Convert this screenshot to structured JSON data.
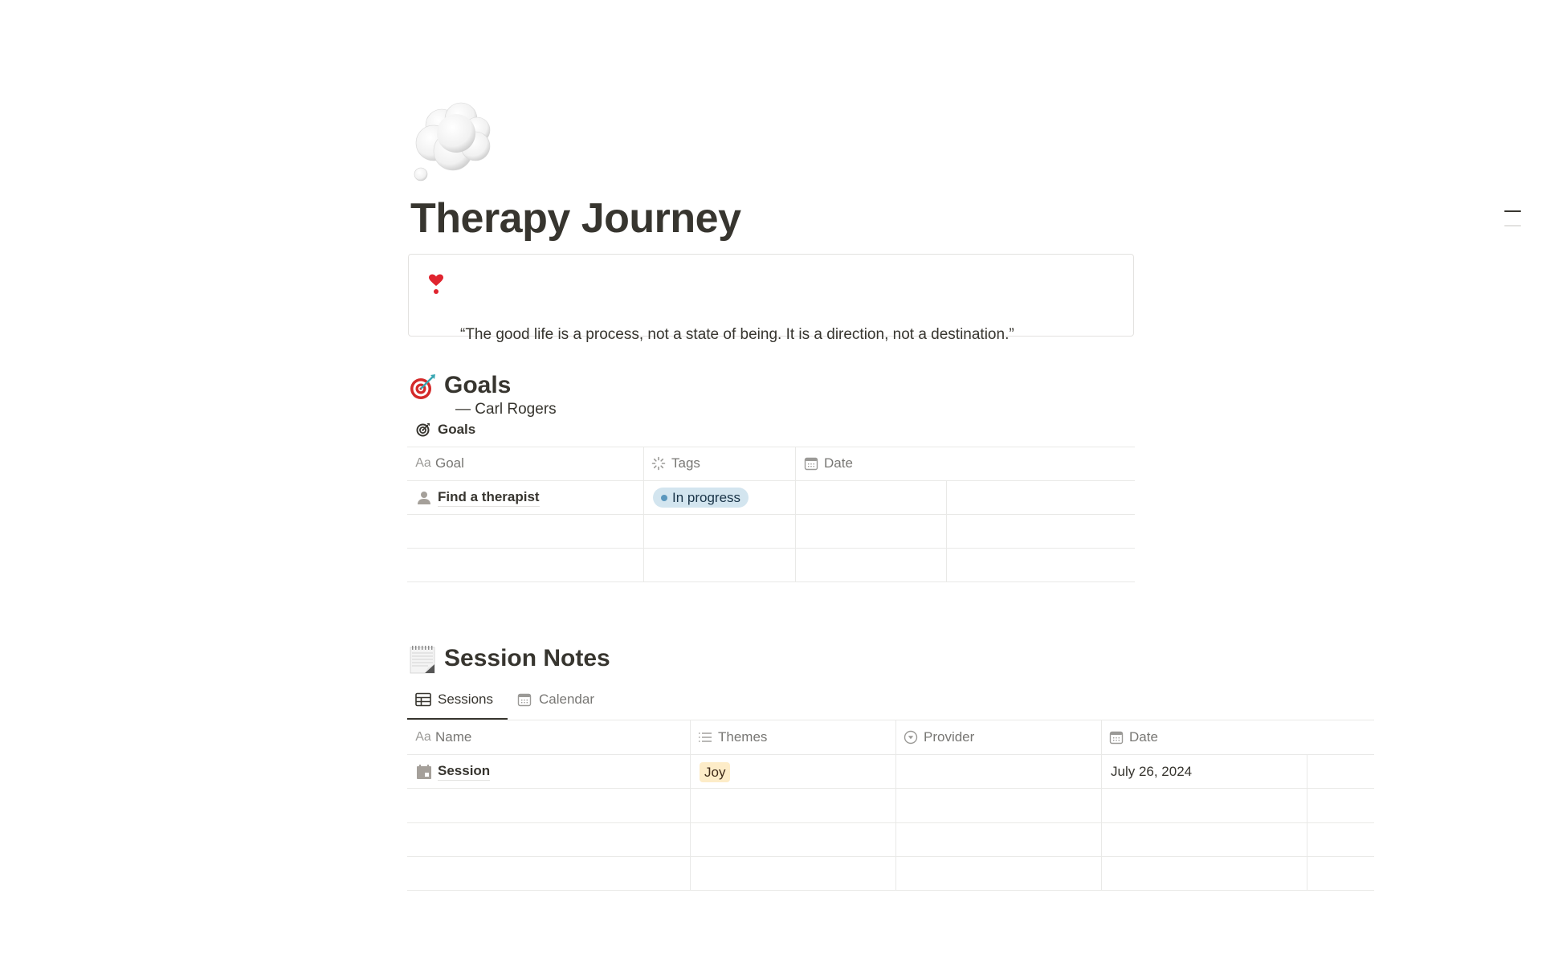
{
  "page": {
    "icon": "thought-balloon-emoji",
    "title": "Therapy Journey"
  },
  "callout": {
    "icon": "heavy-heart-exclamation-emoji",
    "quote": "“The good life is a process, not a state of being. It is a direction, not a destination.”",
    "attribution": "— Carl Rogers"
  },
  "goals_section": {
    "heading_icon": "direct-hit-emoji",
    "heading": "Goals",
    "database": {
      "icon": "target-icon",
      "title": "Goals",
      "columns": [
        {
          "icon": "text-aa-icon",
          "label": "Goal"
        },
        {
          "icon": "status-spinner-icon",
          "label": "Tags"
        },
        {
          "icon": "calendar-icon",
          "label": "Date"
        }
      ],
      "rows": [
        {
          "icon": "person-icon",
          "goal": "Find a therapist",
          "tag": "In progress",
          "date": ""
        },
        {
          "icon": "",
          "goal": "",
          "tag": "",
          "date": ""
        },
        {
          "icon": "",
          "goal": "",
          "tag": "",
          "date": ""
        }
      ],
      "tag_colors": {
        "in_progress_bg": "#d3e5ef",
        "in_progress_dot": "#5b97bd",
        "in_progress_text": "#183347"
      }
    }
  },
  "sessions_section": {
    "heading_icon": "spiral-notepad-emoji",
    "heading": "Session Notes",
    "tabs": [
      {
        "icon": "table-icon",
        "label": "Sessions",
        "active": true
      },
      {
        "icon": "calendar-icon",
        "label": "Calendar",
        "active": false
      }
    ],
    "columns": [
      {
        "icon": "text-aa-icon",
        "label": "Name"
      },
      {
        "icon": "list-icon",
        "label": "Themes"
      },
      {
        "icon": "select-icon",
        "label": "Provider"
      },
      {
        "icon": "calendar-icon",
        "label": "Date"
      }
    ],
    "rows": [
      {
        "icon": "calendar-page-icon",
        "name": "Session",
        "theme": "Joy",
        "provider": "",
        "date": "July 26, 2024"
      },
      {
        "icon": "",
        "name": "",
        "theme": "",
        "provider": "",
        "date": ""
      },
      {
        "icon": "",
        "name": "",
        "theme": "",
        "provider": "",
        "date": ""
      },
      {
        "icon": "",
        "name": "",
        "theme": "",
        "provider": "",
        "date": ""
      }
    ],
    "tag_colors": {
      "joy_bg": "#fdecc8",
      "joy_text": "#402c1b"
    }
  },
  "accent": {
    "text_primary": "#37352f",
    "text_secondary": "#787774",
    "border": "#e9e9e7"
  }
}
